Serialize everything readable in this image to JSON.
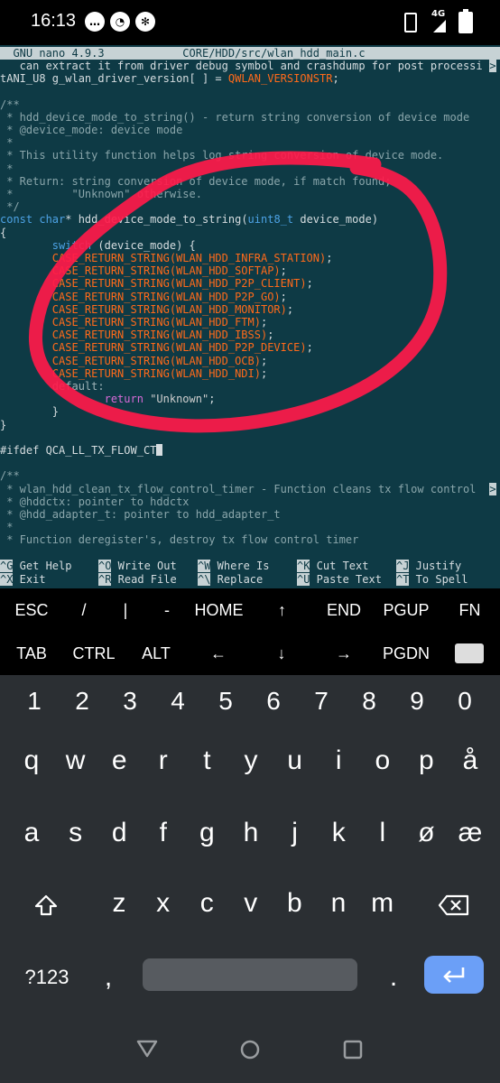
{
  "status": {
    "time": "16:13",
    "network": "4G"
  },
  "editor": {
    "title": "  GNU nano 4.9.3            CORE/HDD/src/wlan_hdd_main.c",
    "lines": [
      "   can extract it from driver debug symbol and crashdump for post processi",
      "tANI_U8 g_wlan_driver_version[ ] = QWLAN_VERSIONSTR;",
      "",
      "/**",
      " * hdd_device_mode_to_string() - return string conversion of device mode",
      " * @device_mode: device mode",
      " *",
      " * This utility function helps log string conversion of device mode.",
      " *",
      " * Return: string conversion of device mode, if match found;",
      " *         \"Unknown\" otherwise.",
      " */",
      "const char* hdd_device_mode_to_string(uint8_t device_mode)",
      "{",
      "        switch (device_mode) {",
      "        CASE_RETURN_STRING(WLAN_HDD_INFRA_STATION);",
      "        CASE_RETURN_STRING(WLAN_HDD_SOFTAP);",
      "        CASE_RETURN_STRING(WLAN_HDD_P2P_CLIENT);",
      "        CASE_RETURN_STRING(WLAN_HDD_P2P_GO);",
      "        CASE_RETURN_STRING(WLAN_HDD_MONITOR);",
      "        CASE_RETURN_STRING(WLAN_HDD_FTM);",
      "        CASE_RETURN_STRING(WLAN_HDD_IBSS);",
      "        CASE_RETURN_STRING(WLAN_HDD_P2P_DEVICE);",
      "        CASE_RETURN_STRING(WLAN_HDD_OCB);",
      "        CASE_RETURN_STRING(WLAN_HDD_NDI);",
      "        default:",
      "                return \"Unknown\";",
      "        }",
      "}",
      "",
      "#ifdef QCA_LL_TX_FLOW_CT",
      "",
      "/**",
      " * wlan_hdd_clean_tx_flow_control_timer - Function cleans tx flow control",
      " * @hddctx: pointer to hddctx",
      " * @hdd_adapter_t: pointer to hdd_adapter_t",
      " *",
      " * Function deregister's, destroy tx flow control timer"
    ],
    "overflow_marker": ">",
    "help": [
      [
        {
          "k": "^G",
          "t": "Get Help"
        },
        {
          "k": "^O",
          "t": "Write Out"
        },
        {
          "k": "^W",
          "t": "Where Is"
        },
        {
          "k": "^K",
          "t": "Cut Text"
        },
        {
          "k": "^J",
          "t": "Justify"
        }
      ],
      [
        {
          "k": "^X",
          "t": "Exit"
        },
        {
          "k": "^R",
          "t": "Read File"
        },
        {
          "k": "^\\",
          "t": "Replace"
        },
        {
          "k": "^U",
          "t": "Paste Text"
        },
        {
          "k": "^T",
          "t": "To Spell"
        }
      ]
    ]
  },
  "extra_keys": {
    "row1": [
      "ESC",
      "/",
      "|",
      "-",
      "HOME",
      "↑",
      "END",
      "PGUP",
      "FN"
    ],
    "row2": [
      "TAB",
      "CTRL",
      "ALT",
      "←",
      "↓",
      "→",
      "PGDN",
      "keyboard-icon"
    ]
  },
  "keyboard": {
    "numbers": [
      "1",
      "2",
      "3",
      "4",
      "5",
      "6",
      "7",
      "8",
      "9",
      "0"
    ],
    "row1": [
      "q",
      "w",
      "e",
      "r",
      "t",
      "y",
      "u",
      "i",
      "o",
      "p",
      "å"
    ],
    "row2": [
      "a",
      "s",
      "d",
      "f",
      "g",
      "h",
      "j",
      "k",
      "l",
      "ø",
      "æ"
    ],
    "row3": [
      "z",
      "x",
      "c",
      "v",
      "b",
      "n",
      "m"
    ],
    "symbols_label": "?123",
    "comma": ",",
    "period": "."
  },
  "colors": {
    "terminal_bg": "#0e3a45",
    "annotation": "#ff1a4a",
    "enter_key": "#6b9ff7"
  }
}
